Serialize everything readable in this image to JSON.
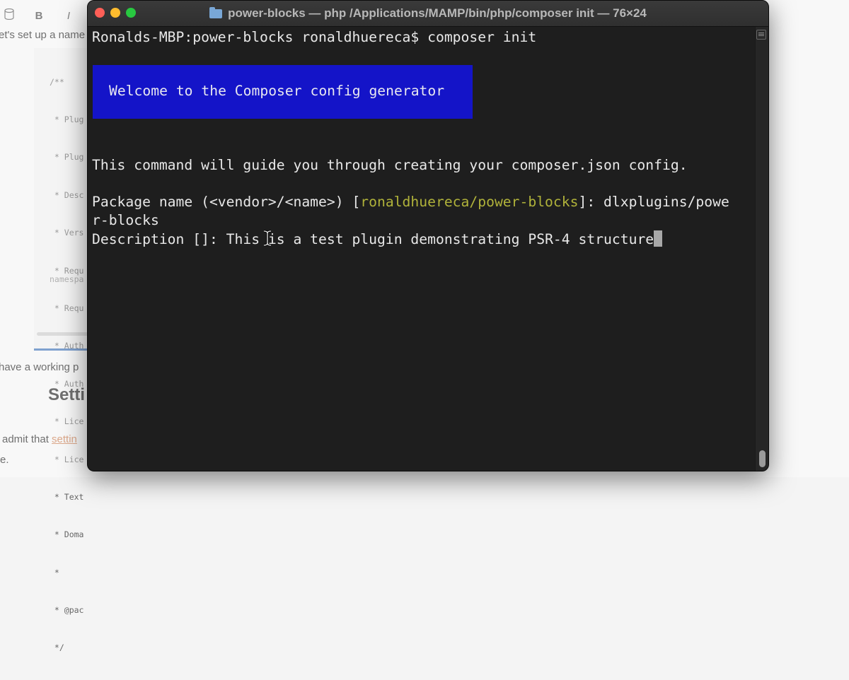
{
  "background_page": {
    "toolbar": [
      "B",
      "I"
    ],
    "intro_text": "et's set up a name",
    "code_lines": [
      "/**",
      " * Plug",
      " * Plug",
      " * Desc",
      " * Vers",
      " * Requ",
      " * Requ",
      " * Auth",
      " * Auth",
      " * Lice",
      " * Lice",
      " * Text",
      " * Doma",
      " *",
      " * @pac",
      " */"
    ],
    "code_namespace": "namespa",
    "working_text": "have a working p",
    "heading": "Setti",
    "admit_text": "admit that ",
    "admit_link": "settin",
    "e_text": "e."
  },
  "window": {
    "title": "power-blocks — php /Applications/MAMP/bin/php/composer init — 76×24",
    "controls": {
      "close": "×",
      "minimize": "−",
      "maximize": "+"
    }
  },
  "terminal": {
    "prompt_line": "Ronalds-MBP:power-blocks ronaldhuereca$ composer init",
    "banner_text": "Welcome to the Composer config generator",
    "guide_line": "This command will guide you through creating your composer.json config.",
    "package_prefix": "Package name (<vendor>/<name>) [",
    "package_default": "ronaldhuereca/power-blocks",
    "package_suffix": "]: dlxplugins/powe",
    "package_wrap": "r-blocks",
    "description_label": "Description []: ",
    "description_value": "This is a test plugin demonstrating PSR-4 structure"
  },
  "colors": {
    "banner_bg": "#1414c8",
    "default_highlight": "#b0b23a",
    "terminal_bg": "#1e1e1e",
    "terminal_text": "#e8e8e8"
  }
}
